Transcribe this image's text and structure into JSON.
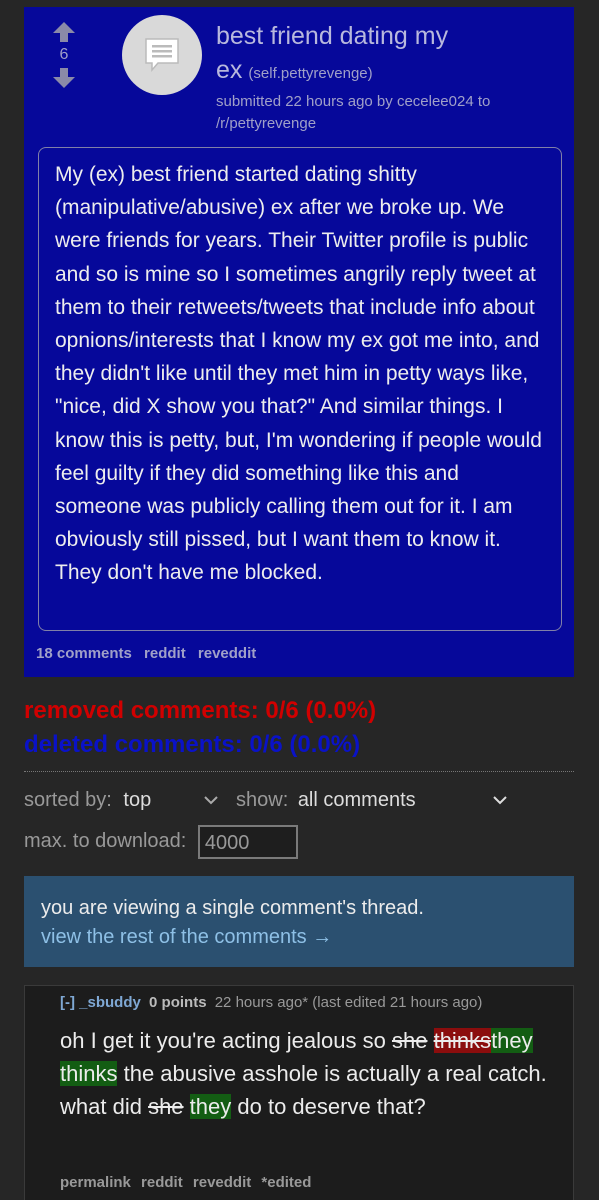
{
  "post": {
    "score": "6",
    "title": "best friend dating my ex",
    "domain": "(self.pettyrevenge)",
    "meta": "submitted 22 hours ago by cecelee024 to /r/pettyrevenge",
    "body": "My (ex) best friend started dating shitty (manipulative/abusive) ex after we broke up. We were friends for years. Their Twitter profile is public and so is mine so I sometimes angrily reply tweet at them to their retweets/tweets that include info about opnions/interests that I know my ex got me into, and they didn't like until they met him in petty ways like, \"nice, did X show you that?\" And similar things. I know this is petty, but, I'm wondering if people would feel guilty if they did something like this and someone was publicly calling them out for it. I am obviously still pissed, but I want them to know it. They don't have me blocked.",
    "links": [
      "18 comments",
      "reddit",
      "reveddit"
    ]
  },
  "stats": {
    "removed": "removed comments: 0/6 (0.0%)",
    "deleted": "deleted comments: 0/6 (0.0%)"
  },
  "controls": {
    "sorted_label": "sorted by:",
    "sorted_value": "top",
    "show_label": "show:",
    "show_value": "all comments",
    "download_label": "max. to download:",
    "download_value": "4000"
  },
  "thread_note": {
    "text": "you are viewing a single comment's thread.",
    "link": "view the rest of the comments →"
  },
  "comment": {
    "toggle": "[-]",
    "author": "_sbuddy",
    "points": "0 points",
    "time": "22 hours ago* (last edited 21 hours ago)",
    "body_1": "oh I get it you're acting jealous so ",
    "del_1": "she",
    "body_2": " ",
    "del_2": "thinks",
    "ins_2": "they thinks",
    "body_3": " the abusive asshole is actually a real catch. what did ",
    "del_3": "she",
    "body_4": " ",
    "ins_4": "they",
    "body_5": " do to deserve that?",
    "links": [
      "permalink",
      "reddit",
      "reveddit",
      "*edited"
    ]
  },
  "colors": {
    "post_bg": "#06089a",
    "removed": "#d10000",
    "deleted": "#0a12c8",
    "note_bg": "#2b5070",
    "link_blue": "#8ec0e6"
  }
}
